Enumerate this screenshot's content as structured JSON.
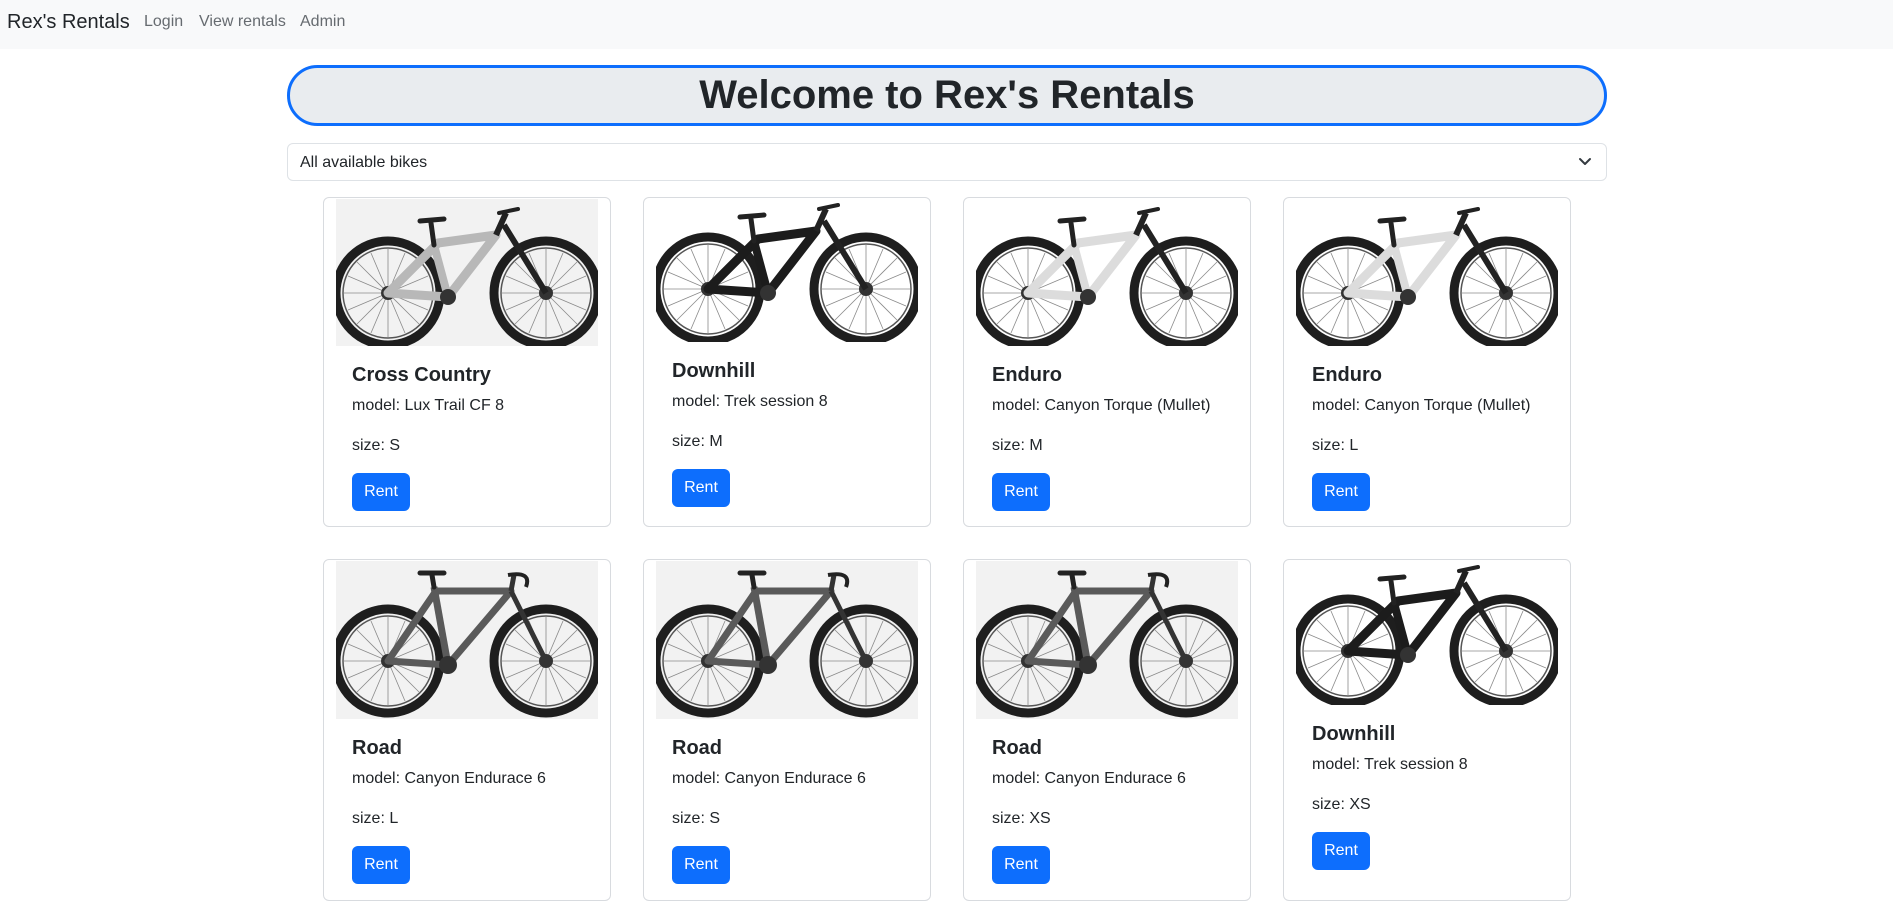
{
  "navbar": {
    "brand": "Rex's Rentals",
    "links": [
      "Login",
      "View rentals",
      "Admin"
    ]
  },
  "header": {
    "title": "Welcome to Rex's Rentals"
  },
  "filter": {
    "selected": "All available bikes"
  },
  "colors": {
    "primary": "#0d6efd",
    "navbar_bg": "#f8f9fa",
    "hero_bg": "#e9ecef"
  },
  "bikes": [
    {
      "category": "Cross Country",
      "model": "model: Lux Trail CF 8",
      "size": "size: S",
      "button": "Rent",
      "image": "silver-full-suspension-bike"
    },
    {
      "category": "Downhill",
      "model": "model: Trek session 8",
      "size": "size: M",
      "button": "Rent",
      "image": "black-downhill-bike"
    },
    {
      "category": "Enduro",
      "model": "model: Canyon Torque (Mullet)",
      "size": "size: M",
      "button": "Rent",
      "image": "white-enduro-bike"
    },
    {
      "category": "Enduro",
      "model": "model: Canyon Torque (Mullet)",
      "size": "size: L",
      "button": "Rent",
      "image": "white-enduro-bike"
    },
    {
      "category": "Road",
      "model": "model: Canyon Endurace 6",
      "size": "size: L",
      "button": "Rent",
      "image": "grey-road-bike"
    },
    {
      "category": "Road",
      "model": "model: Canyon Endurace 6",
      "size": "size: S",
      "button": "Rent",
      "image": "grey-road-bike"
    },
    {
      "category": "Road",
      "model": "model: Canyon Endurace 6",
      "size": "size: XS",
      "button": "Rent",
      "image": "grey-road-bike"
    },
    {
      "category": "Downhill",
      "model": "model: Trek session 8",
      "size": "size: XS",
      "button": "Rent",
      "image": "black-downhill-bike"
    }
  ]
}
